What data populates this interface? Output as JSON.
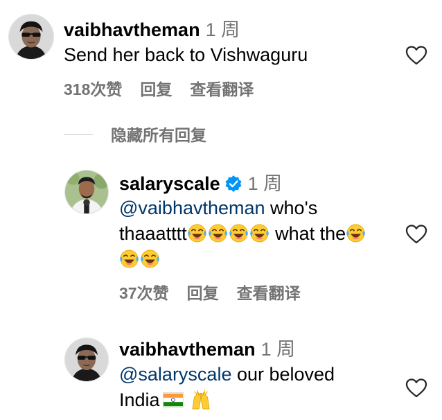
{
  "comments": [
    {
      "username": "vaibhavtheman",
      "time": "1 周",
      "text": "Send her back to Vishwaguru",
      "likes": "318次赞",
      "reply": "回复",
      "translate": "查看翻译",
      "avatar_icon": "avatar-sunglasses"
    },
    {
      "username": "salaryscale",
      "time": "1 周",
      "mention": "@vaibhavtheman",
      "text_1": " who's",
      "text_2": "thaaatttt",
      "text_3": " what the",
      "likes": "37次赞",
      "reply": "回复",
      "translate": "查看翻译",
      "avatar_icon": "avatar-man-microphone",
      "verified_icon": "verified-badge-icon",
      "emoji_icon": "face-with-tears-of-joy-icon"
    },
    {
      "username": "vaibhavtheman",
      "time": "1 周",
      "mention": "@salaryscale",
      "text_1": " our beloved",
      "text_2": "India",
      "avatar_icon": "avatar-sunglasses",
      "flag_icon": "india-flag-icon",
      "hands_icon": "raising-hands-icon"
    }
  ],
  "hide_replies": "隐藏所有回复",
  "colors": {
    "secondary_text": "#737373",
    "mention": "#00376b",
    "verified": "#0095f6"
  }
}
